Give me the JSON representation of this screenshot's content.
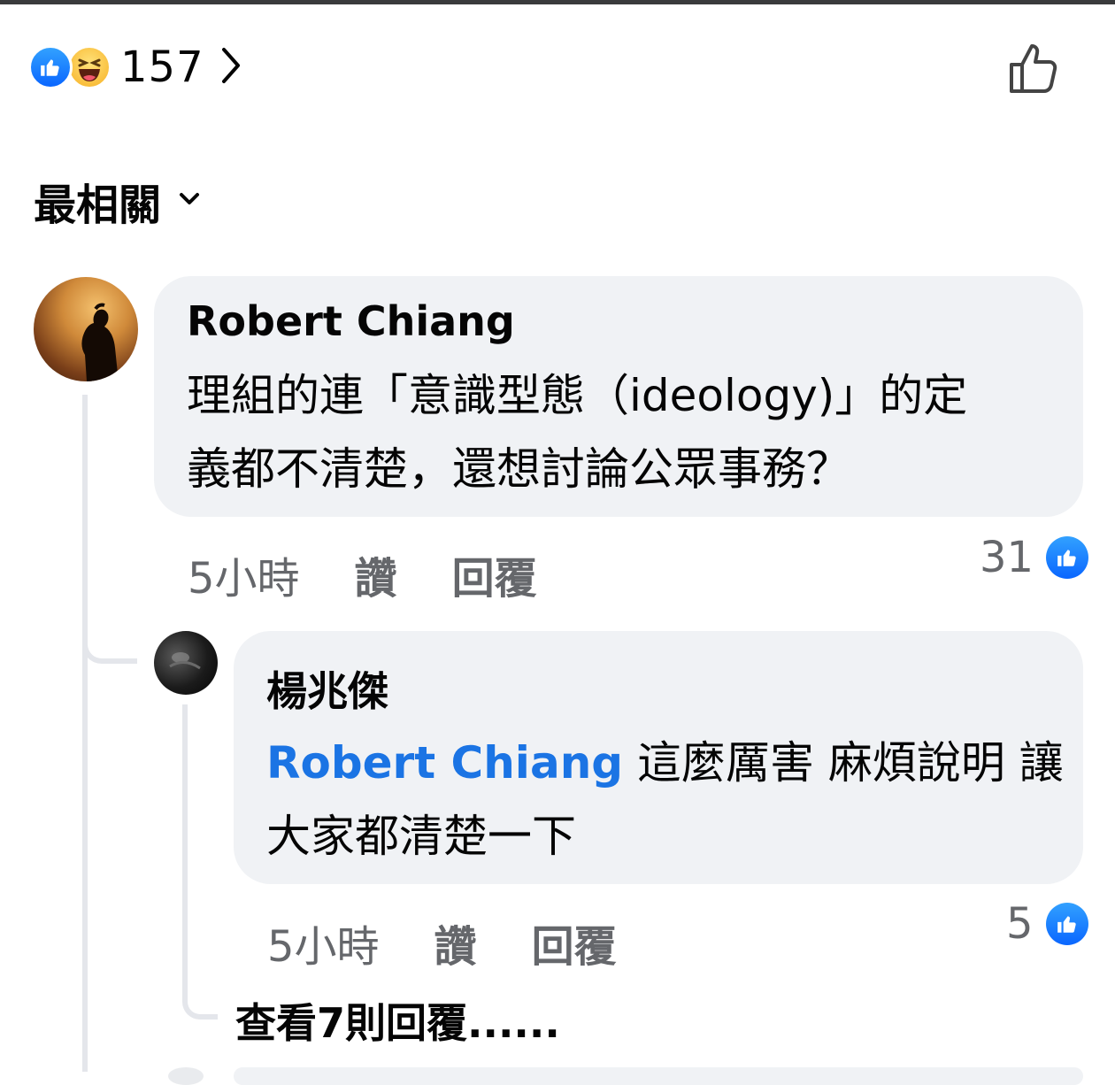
{
  "reactions": {
    "count": "157",
    "icons": [
      "like-icon",
      "haha-icon"
    ]
  },
  "sort": {
    "label": "最相關"
  },
  "comments": [
    {
      "author": "Robert Chiang",
      "text_line1": "理組的連「意識型態（ideology)」的定",
      "text_line2": "義都不清楚，還想討論公眾事務？",
      "time": "5小時",
      "like_label": "讚",
      "reply_label": "回覆",
      "like_count": "31"
    },
    {
      "author": "楊兆傑",
      "mention": "Robert Chiang",
      "text_line1_rest": " 這麼厲害 麻煩說明 讓",
      "text_line2": "大家都清楚一下",
      "time": "5小時",
      "like_label": "讚",
      "reply_label": "回覆",
      "like_count": "5"
    }
  ],
  "view_more": "查看7則回覆......",
  "colors": {
    "accent": "#1b74e4",
    "bubble": "#f0f2f5",
    "meta": "#65676b",
    "like_blue": "#0a66ff"
  }
}
